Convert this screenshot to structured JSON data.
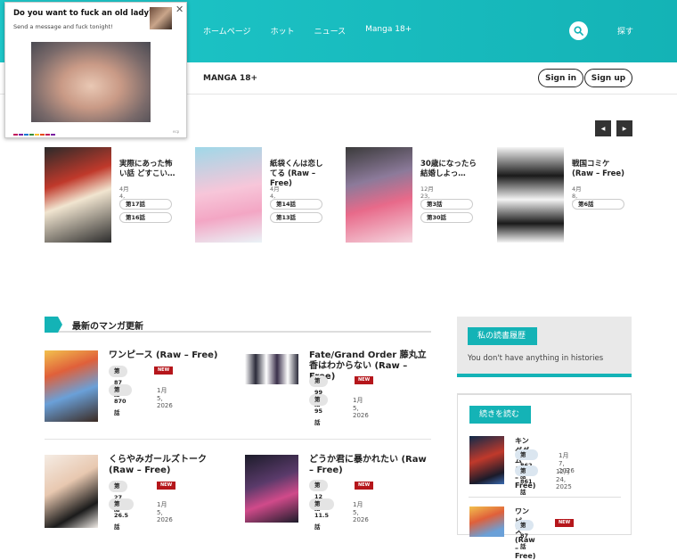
{
  "header": {
    "nav": [
      "ホームページ",
      "ホット",
      "ニュース",
      "Manga 18+"
    ],
    "explore_label": "探す",
    "sub_nav_label": "MANGA 18+",
    "signin_label": "Sign in",
    "signup_label": "Sign up",
    "search_icon": "search-icon",
    "accent_color": "#1ab8bb"
  },
  "ad": {
    "title": "Do you want to fuck an old lady?",
    "subtitle": "Send a message and fuck tonight!",
    "close_label": "✕",
    "tiny_label": "ecp"
  },
  "carousel": {
    "prev_label": "◀",
    "next_label": "▶",
    "items": [
      {
        "title": "実際にあった怖い話 どすこい…",
        "date": "4月 4, 2025",
        "chapters": [
          "第17話",
          "第16話"
        ]
      },
      {
        "title": "紙袋くんは恋してる (Raw – Free)",
        "date": "4月 4, 2025",
        "chapters": [
          "第14話",
          "第13話"
        ]
      },
      {
        "title": "30歳になったら結婚しよっ…",
        "date": "12月 23, 2025",
        "chapters": [
          "第3話",
          "第30話"
        ]
      },
      {
        "title": "戦国コミケ (Raw – Free)",
        "date": "4月 8, 2025",
        "chapters": [
          "第6話"
        ]
      }
    ]
  },
  "latest": {
    "heading": "最新のマンガ更新",
    "new_badge": "NEW",
    "items": [
      {
        "title": "ワンピース (Raw – Free)",
        "chapters": [
          {
            "label": "第87話",
            "date": "",
            "new": true
          },
          {
            "label": "第870話",
            "date": "1月 5, 2026",
            "new": false
          }
        ]
      },
      {
        "title": "Fate/Grand Order 藤丸立香はわからない (Raw – Free)",
        "chapters": [
          {
            "label": "第99話",
            "date": "",
            "new": true
          },
          {
            "label": "第95話",
            "date": "1月 5, 2026",
            "new": false
          }
        ]
      },
      {
        "title": "くらやみガールズトーク (Raw – Free)",
        "chapters": [
          {
            "label": "第27話",
            "date": "",
            "new": true
          },
          {
            "label": "第26.5話",
            "date": "1月 5, 2026",
            "new": false
          }
        ]
      },
      {
        "title": "どうか君に暴かれたい (Raw – Free)",
        "chapters": [
          {
            "label": "第12話",
            "date": "",
            "new": true
          },
          {
            "label": "第11.5話",
            "date": "1月 5, 2026",
            "new": false
          }
        ]
      }
    ]
  },
  "sidebar": {
    "history_title": "私の読書履歴",
    "history_empty": "You don't have anything in histories",
    "continue_title": "続きを読む",
    "items": [
      {
        "title": "キングダム (Raw – Free)",
        "chapters": [
          {
            "label": "第862話",
            "date": "1月 7, 2026"
          },
          {
            "label": "第861話",
            "date": "12月 24, 2025"
          }
        ]
      },
      {
        "title": "ワンピース (Raw – Free)",
        "chapters": [
          {
            "label": "第87話",
            "date": ""
          }
        ],
        "new": "NEW"
      }
    ]
  }
}
